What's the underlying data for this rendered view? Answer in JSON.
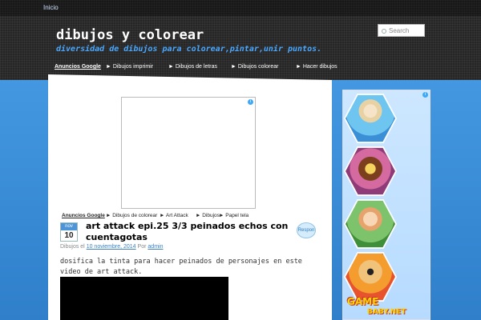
{
  "topbar": {
    "home_link": "Inicio"
  },
  "site": {
    "title": "dibujos y colorear",
    "tagline": "diversidad de dibujos para colorear,pintar,unir puntos."
  },
  "search": {
    "placeholder": "Search"
  },
  "nav": {
    "label": "Anuncios Google",
    "items": [
      {
        "label": "► Dibujos imprimir"
      },
      {
        "label": "► Dibujos de letras"
      },
      {
        "label": "► Dibujos colorear"
      },
      {
        "label": "► Hacer dibujos"
      }
    ]
  },
  "link_ads": {
    "label": "Anuncios Google",
    "items": [
      {
        "label": "► Dibujos de colorear"
      },
      {
        "label": "► Art Attack"
      },
      {
        "label": "► Dibujos"
      },
      {
        "label": "► Papel tela"
      }
    ]
  },
  "ad_icon": "i",
  "post": {
    "date_month": "nov",
    "date_day": "10",
    "title": "art attack epi.25 3/3 peinados echos con cuentagotas",
    "comments_bubble": "Respon",
    "meta_prefix": "Dibujos el",
    "meta_date": "10 noviembre, 2014",
    "meta_by": "Por",
    "meta_author": "admin",
    "body": "dosifica la tinta para hacer peinados de personajes en este video de art attack."
  },
  "sidebar_ad": {
    "brand_line1": "GAME",
    "brand_line2": "BABY.NET"
  },
  "colors": {
    "header_bg": "#262626",
    "accent_blue": "#4aa8ff",
    "page_bg": "#3a8fd6"
  }
}
